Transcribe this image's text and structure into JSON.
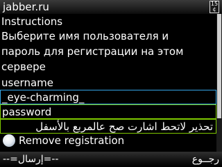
{
  "window": {
    "title": "jabber.ru",
    "input_mode_top": "15",
    "input_mode_bottom": "¢",
    "input_mode_icon": "input-mode-indicator"
  },
  "form": {
    "instructions_label": "Instructions",
    "instructions_text_lines": [
      "Выберите имя пользователя и",
      "пароль для регистрации на этом",
      "сервере"
    ],
    "username_label": "username",
    "username_value": "_eye-charming_",
    "password_label": "password",
    "password_value": "تحذير لاتحط اشارت صح عالمربع بالأسفل",
    "remove_registration": {
      "label": "Remove registration",
      "checked": false
    }
  },
  "softkeys": {
    "left": "--=إرسال=--",
    "right": "رجــوع"
  },
  "colors": {
    "field_border": "#34a6e8",
    "focused_border": "#7ec800",
    "background": "#000000",
    "text": "#ffffff"
  }
}
